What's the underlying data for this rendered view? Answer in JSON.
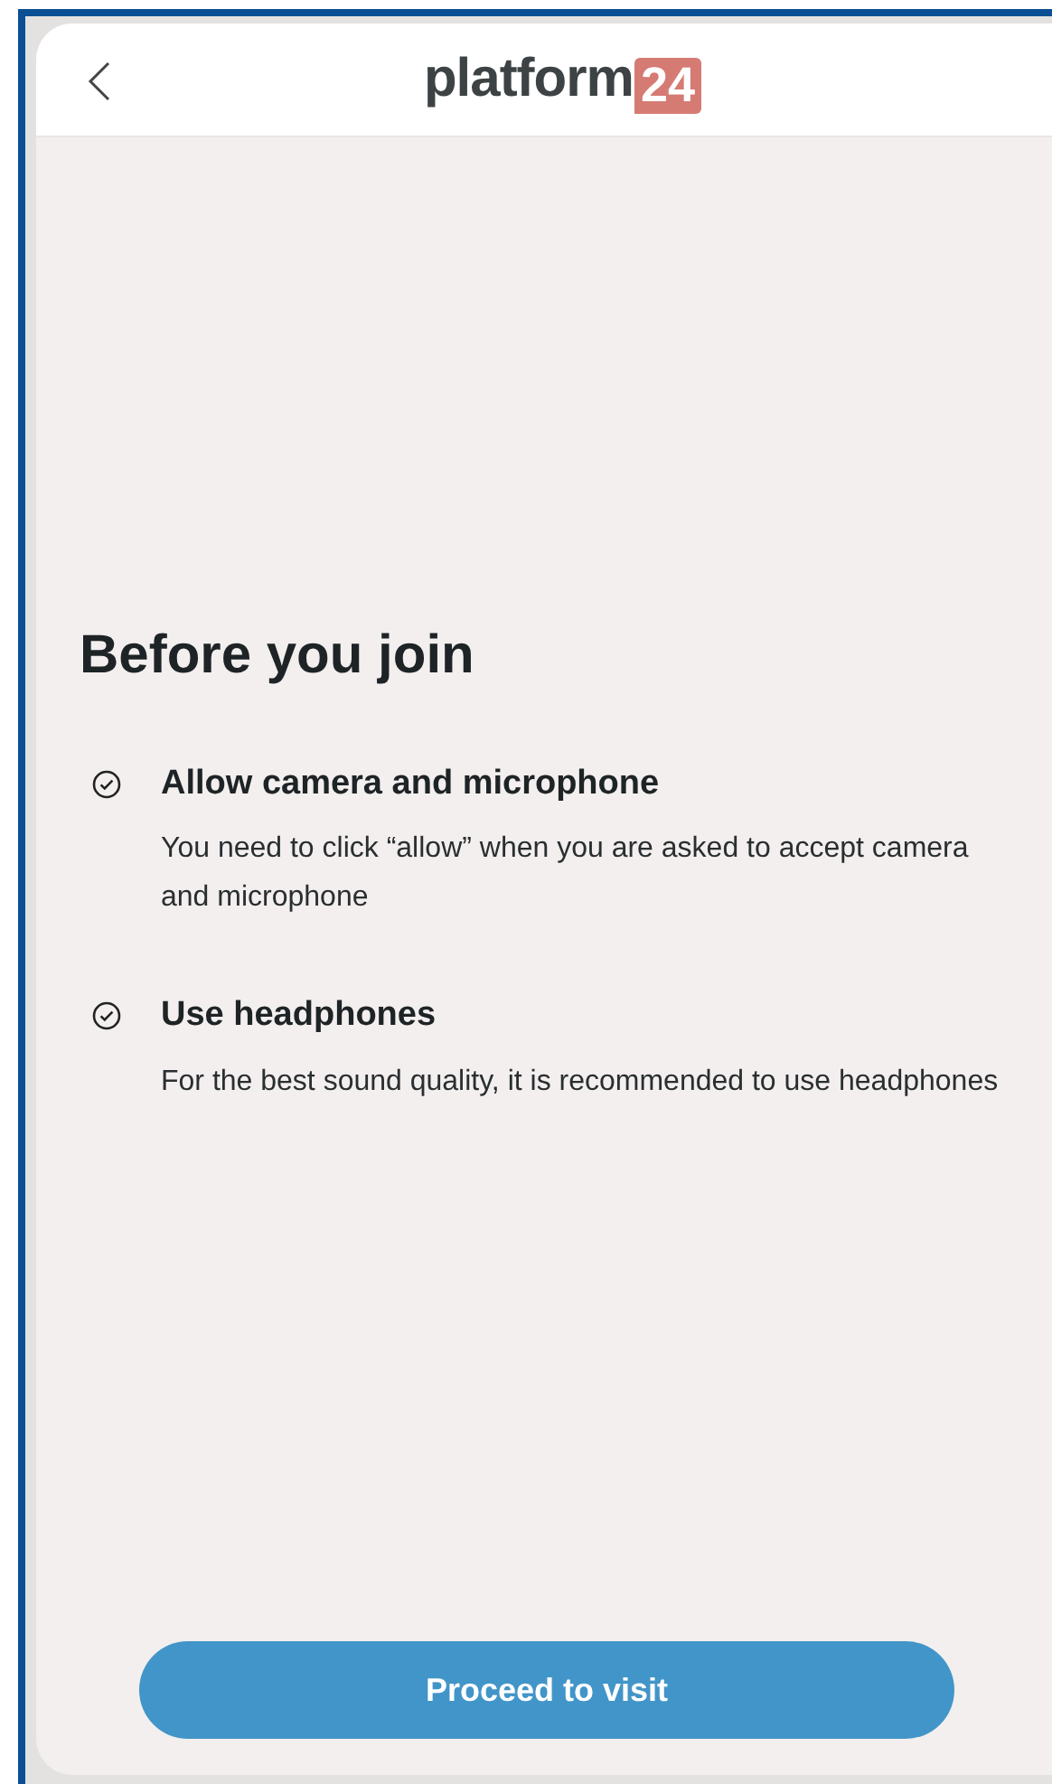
{
  "header": {
    "logo_text": "platform",
    "logo_badge": "24"
  },
  "title": "Before you join",
  "items": [
    {
      "title": "Allow camera and microphone",
      "text": "You need to click “allow” when you are asked to accept camera and microphone",
      "checked": true
    },
    {
      "title": "Use headphones",
      "text": "For the best sound quality, it is recommended to use headphones",
      "checked": true
    }
  ],
  "button": "Proceed to visit"
}
